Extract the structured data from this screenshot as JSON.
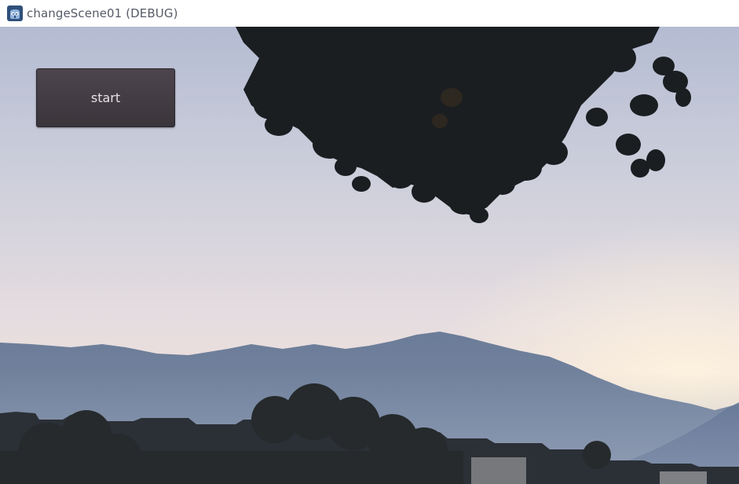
{
  "window": {
    "title": "changeScene01 (DEBUG)",
    "icon": "godot-engine-icon"
  },
  "scene": {
    "background": "dawn-sky-mountains-village-with-leaves",
    "start_button": {
      "label": "start"
    }
  },
  "colors": {
    "sky_top": "#b7bfd3",
    "sky_bottom": "#f2e2d6",
    "glow": "#fff0dc",
    "mountain_far": "#6a7d99",
    "mountain_near": "#55678a",
    "foliage": "#1c2023",
    "button_bg": "#433c44",
    "button_text": "#e6e2e6"
  }
}
